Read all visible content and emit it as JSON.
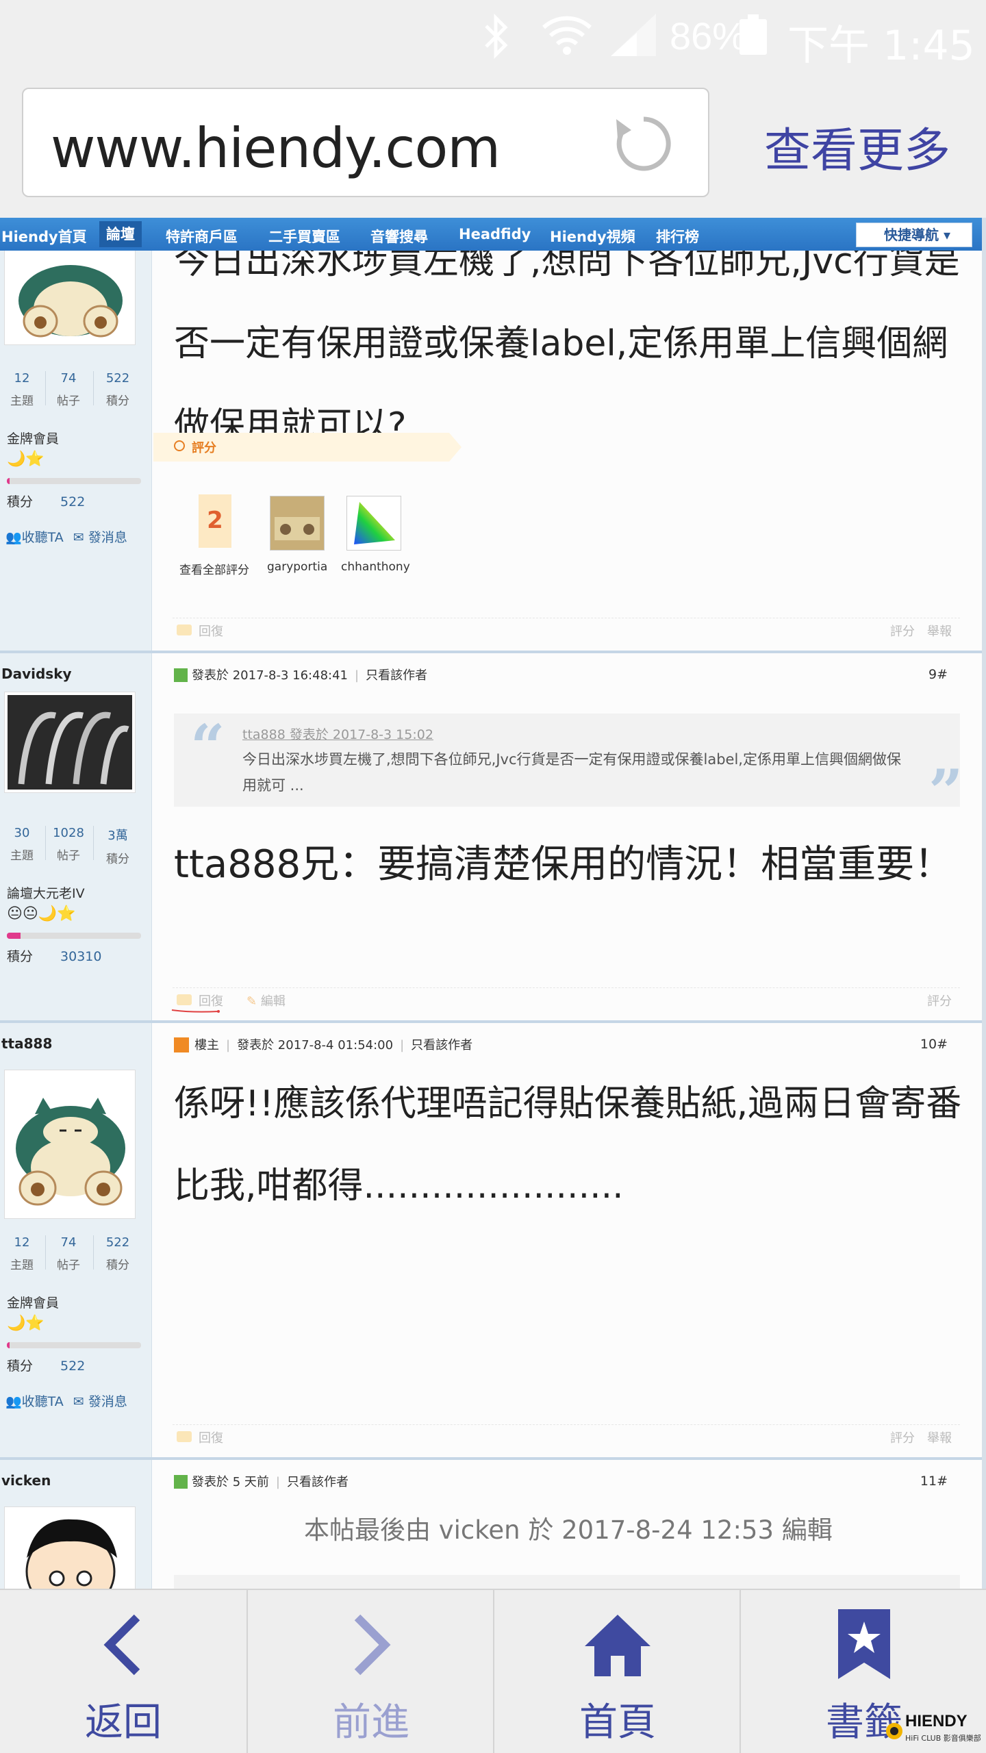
{
  "status_bar": {
    "battery": "86%",
    "time": "下午 1:45"
  },
  "browser": {
    "url": "www.hiendy.com",
    "more_label": "查看更多"
  },
  "site_nav": {
    "items": [
      "Hiendy首頁",
      "論壇",
      "特許商戶區",
      "二手買賣區",
      "音響搜尋",
      "Headfidy",
      "Hiendy視頻",
      "排行榜"
    ],
    "quick_nav": "快捷導航"
  },
  "post8": {
    "user": {
      "topics": "12",
      "posts": "74",
      "points": "522",
      "topics_label": "主題",
      "posts_label": "帖子",
      "points_label": "積分",
      "rank": "金牌會員",
      "points_row_label": "積分",
      "points_value": "522",
      "follow": "收聽TA",
      "message": "發消息",
      "progress": 0.02
    },
    "text": "今日出深水埗買左機了,想問下各位師兄,Jvc行貨是否一定有保用證或保養label,定係用單上信興個網做保用就可以?",
    "rating_label": "評分",
    "ratings": {
      "count": "2",
      "all_label": "查看全部評分",
      "raters": [
        "garyportia",
        "chhanthony"
      ]
    },
    "footer": {
      "reply": "回復",
      "rate": "評分",
      "report": "舉報"
    }
  },
  "post9": {
    "username": "Davidsky",
    "user": {
      "topics": "30",
      "posts": "1028",
      "points": "3萬",
      "topics_label": "主題",
      "posts_label": "帖子",
      "points_label": "積分",
      "rank": "論壇大元老IV",
      "points_row_label": "積分",
      "points_value": "30310",
      "progress": 0.1
    },
    "meta": {
      "posted": "發表於 2017-8-3 16:48:41",
      "only_author": "只看該作者",
      "floor": "9#"
    },
    "quote": {
      "header": "tta888 發表於 2017-8-3 15:02",
      "text": "今日出深水埗買左機了,想問下各位師兄,Jvc行貨是否一定有保用證或保養label,定係用單上信興個網做保用就可 ..."
    },
    "text": "tta888兄：要搞清楚保用的情況！相當重要！",
    "footer": {
      "reply": "回復",
      "edit": "編輯",
      "rate": "評分"
    }
  },
  "post10": {
    "username": "tta888",
    "user": {
      "topics": "12",
      "posts": "74",
      "points": "522",
      "topics_label": "主題",
      "posts_label": "帖子",
      "points_label": "積分",
      "rank": "金牌會員",
      "points_row_label": "積分",
      "points_value": "522",
      "follow": "收聽TA",
      "message": "發消息",
      "progress": 0.02
    },
    "meta": {
      "owner": "樓主",
      "posted": "發表於 2017-8-4 01:54:00",
      "only_author": "只看該作者",
      "floor": "10#"
    },
    "text": "係呀!!應該係代理唔記得貼保養貼紙,過兩日會寄番比我,咁都得.......................",
    "footer": {
      "reply": "回復",
      "rate": "評分",
      "report": "舉報"
    }
  },
  "post11": {
    "username": "vicken",
    "meta": {
      "posted": "發表於 5 天前",
      "only_author": "只看該作者",
      "floor": "11#"
    },
    "edit_note": "本帖最後由 vicken 於 2017-8-24 12:53 編輯"
  },
  "bottom_bar": {
    "back": "返回",
    "forward": "前進",
    "home": "首頁",
    "bookmarks": "書籤"
  },
  "watermark": {
    "brand": "HIENDY",
    "sub": "HiFi CLUB 影音俱樂部"
  },
  "colors": {
    "nav_blue": "#2a74c4",
    "toolbar_icon": "#3f4aa0",
    "link": "#336699"
  }
}
